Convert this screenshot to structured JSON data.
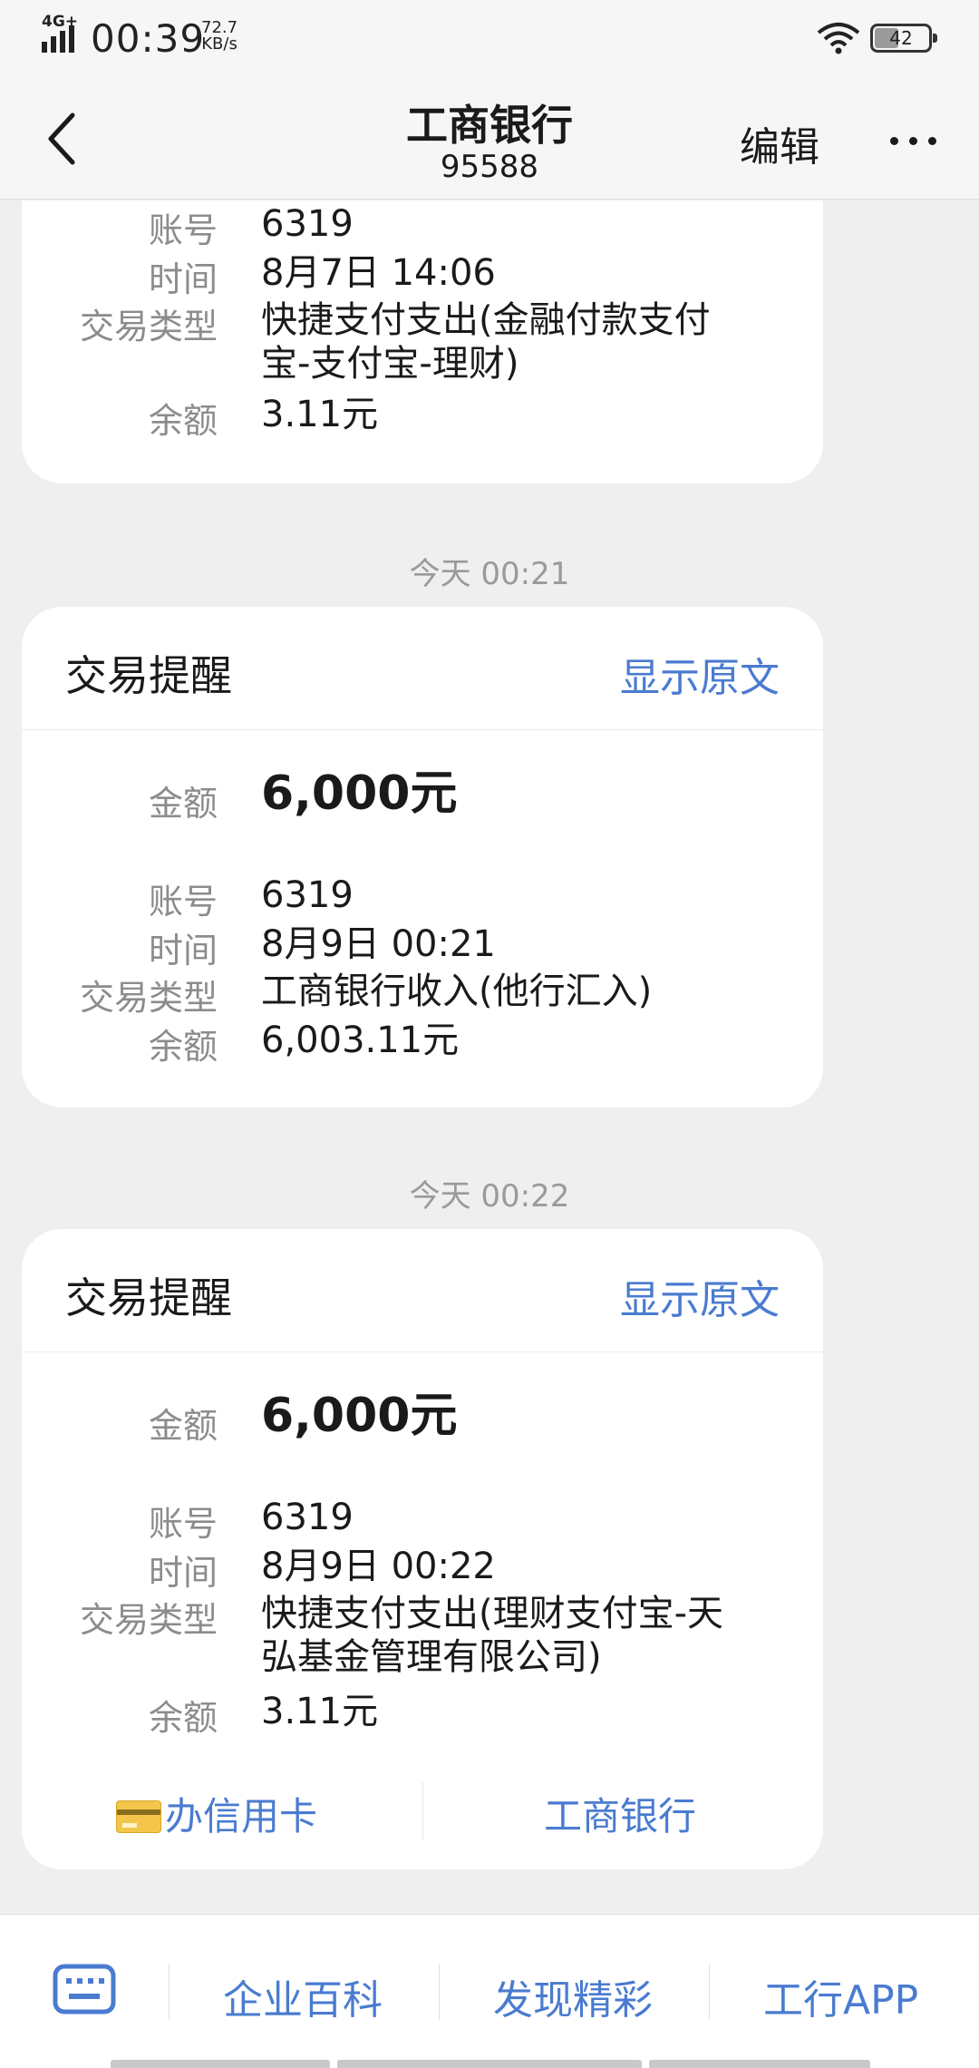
{
  "status_bar": {
    "network": "4G+",
    "time": "00:39",
    "speed_value": "72.7",
    "speed_unit": "KB/s",
    "battery": "42"
  },
  "header": {
    "title": "工商银行",
    "number": "95588",
    "edit_label": "编辑"
  },
  "messages": [
    {
      "partial": true,
      "rows": [
        {
          "label": "账号",
          "value": "6319"
        },
        {
          "label": "时间",
          "value": "8月7日 14:06"
        },
        {
          "label": "交易类型",
          "value_lines": [
            "快捷支付支出(金融付款支付",
            "宝-支付宝-理财)"
          ]
        },
        {
          "label": "余额",
          "value": "3.11元"
        }
      ]
    },
    {
      "timestamp": "今天 00:21",
      "title": "交易提醒",
      "show_original": "显示原文",
      "amount_label": "金额",
      "amount": "6,000元",
      "rows": [
        {
          "label": "账号",
          "value": "6319"
        },
        {
          "label": "时间",
          "value": "8月9日 00:21"
        },
        {
          "label": "交易类型",
          "value": "工商银行收入(他行汇入)"
        },
        {
          "label": "余额",
          "value": "6,003.11元"
        }
      ]
    },
    {
      "timestamp": "今天 00:22",
      "title": "交易提醒",
      "show_original": "显示原文",
      "amount_label": "金额",
      "amount": "6,000元",
      "rows": [
        {
          "label": "账号",
          "value": "6319"
        },
        {
          "label": "时间",
          "value": "8月9日 00:22"
        },
        {
          "label": "交易类型",
          "value_lines": [
            "快捷支付支出(理财支付宝-天",
            "弘基金管理有限公司)"
          ]
        },
        {
          "label": "余额",
          "value": "3.11元"
        }
      ],
      "footer": {
        "left_label": "办信用卡",
        "left_icon": "credit-card-icon",
        "right_label": "工商银行"
      }
    }
  ],
  "bottom_menu": {
    "keyboard_icon": "keyboard-icon",
    "items": [
      "企业百科",
      "发现精彩",
      "工行APP"
    ]
  },
  "colors": {
    "accent": "#4a7bd0",
    "background": "#efefef",
    "card": "#ffffff",
    "label_gray": "#8c8c8c"
  }
}
